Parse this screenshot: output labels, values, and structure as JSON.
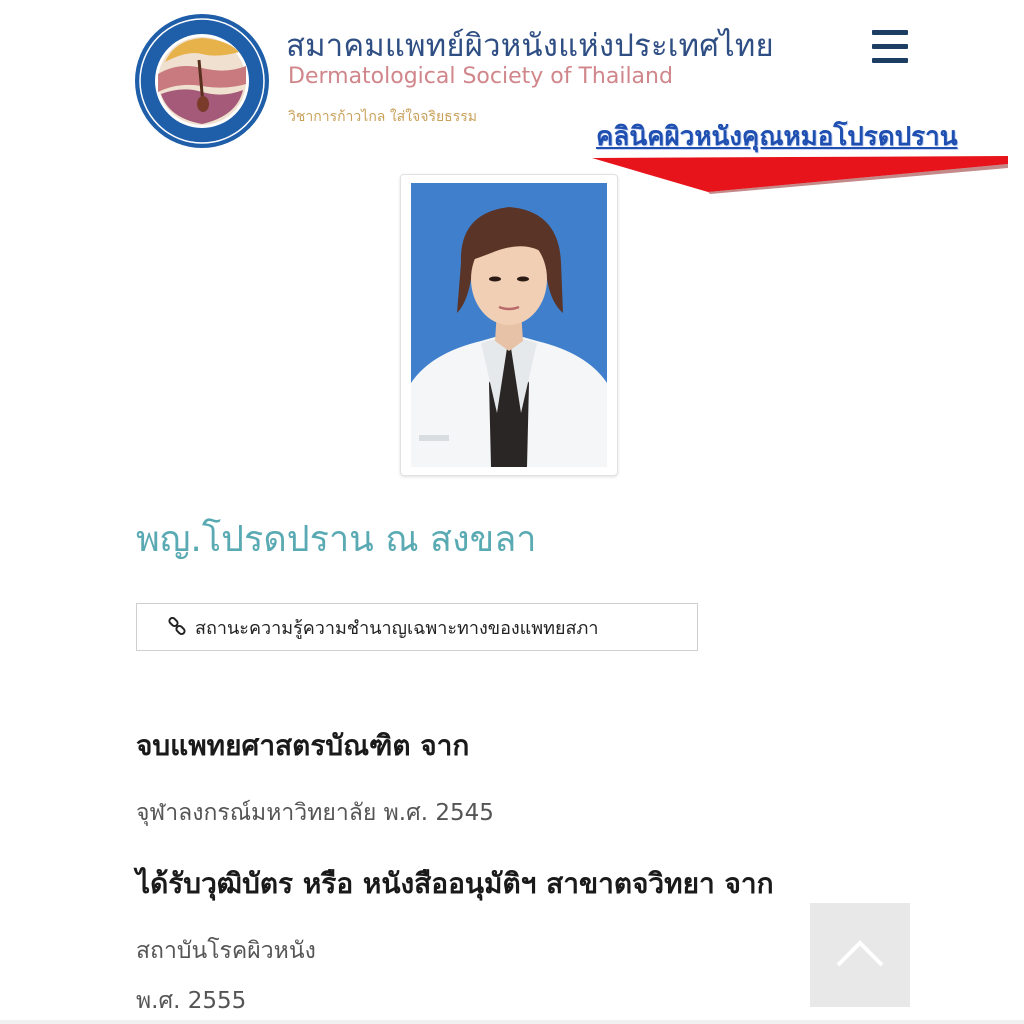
{
  "header": {
    "title_th": "สมาคมแพทย์ผิวหนังแห่งประเทศไทย",
    "title_en": "Dermatological Society of Thailand",
    "tagline": "วิชาการก้าวไกล ใส่ใจจริยธรรม",
    "logo_icon": "society-seal-icon",
    "menu_icon": "hamburger-menu-icon"
  },
  "banner": {
    "text": "คลินิคผิวหนังคุณหมอโปรดปราน",
    "color": "#1f4fb0",
    "arrow_color": "#e8141c"
  },
  "profile": {
    "name": "พญ.โปรดปราน ณ สงขลา",
    "name_color": "#5aaab3",
    "status_link": {
      "icon": "link-icon",
      "label": "สถานะความรู้ความชำนาญเฉพาะทางของแพทยสภา"
    }
  },
  "education": [
    {
      "heading": "จบแพทยศาสตรบัณฑิต จาก",
      "lines": [
        "จุฬาลงกรณ์มหาวิทยาลัย พ.ศ. 2545"
      ]
    },
    {
      "heading": "ได้รับวุฒิบัตร หรือ หนังสืออนุมัติฯ สาขาตจวิทยา จาก",
      "lines": [
        "สถาบันโรคผิวหนัง",
        "พ.ศ. 2555"
      ]
    }
  ],
  "controls": {
    "back_to_top_icon": "chevron-up-icon"
  }
}
